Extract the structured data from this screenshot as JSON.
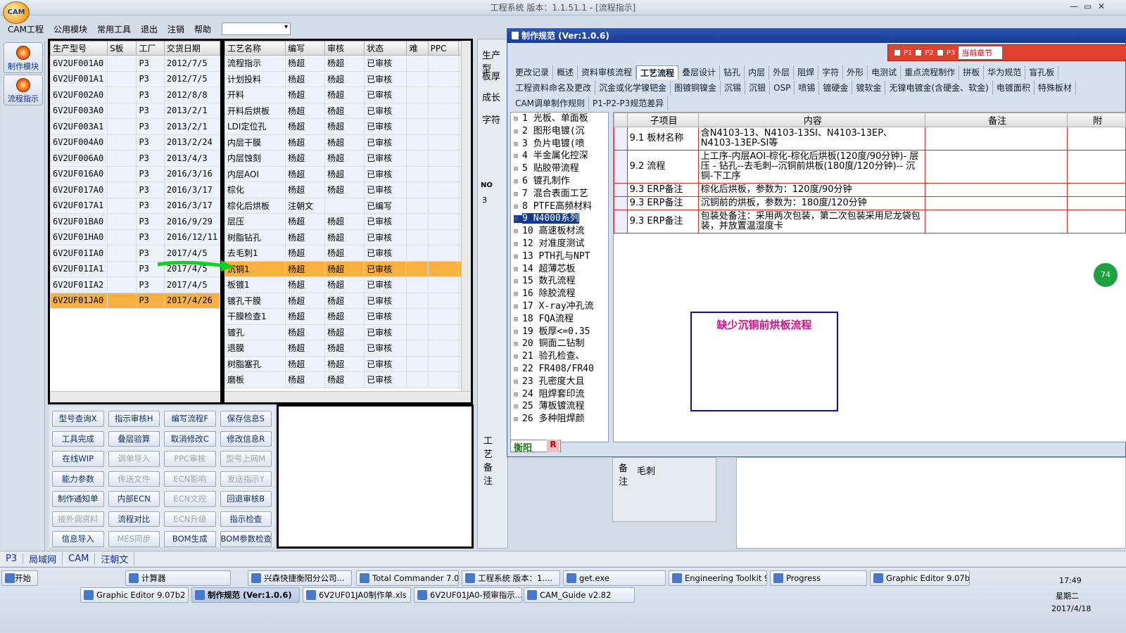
{
  "window": {
    "title": "工程系统   版本：1.1.51.1 - [流程指示]",
    "logo": "CAM"
  },
  "menu": [
    "CAM工程",
    "公用模块",
    "常用工具",
    "退出",
    "注销",
    "帮助"
  ],
  "sidebar": [
    {
      "label": "制作模块"
    },
    {
      "label": "流程指示"
    }
  ],
  "orders": {
    "columns": [
      "生产型号",
      "S板",
      "工厂",
      "交货日期"
    ],
    "rows": [
      [
        "6V2UF001A0",
        "",
        "P3",
        "2012/7/5"
      ],
      [
        "6V2UF001A1",
        "",
        "P3",
        "2012/7/5"
      ],
      [
        "6V2UF002A0",
        "",
        "P3",
        "2012/8/8"
      ],
      [
        "6V2UF003A0",
        "",
        "P3",
        "2013/2/1"
      ],
      [
        "6V2UF003A1",
        "",
        "P3",
        "2013/2/1"
      ],
      [
        "6V2UF004A0",
        "",
        "P3",
        "2013/2/24"
      ],
      [
        "6V2UF006A0",
        "",
        "P3",
        "2013/4/3"
      ],
      [
        "6V2UF016A0",
        "",
        "P3",
        "2016/3/16"
      ],
      [
        "6V2UF017A0",
        "",
        "P3",
        "2016/3/17"
      ],
      [
        "6V2UF017A1",
        "",
        "P3",
        "2016/3/17"
      ],
      [
        "6V2UF01BA0",
        "",
        "P3",
        "2016/9/29"
      ],
      [
        "6V2UF01HA0",
        "",
        "P3",
        "2016/12/11"
      ],
      [
        "6V2UF01IA0",
        "",
        "P3",
        "2017/4/5"
      ],
      [
        "6V2UF01IA1",
        "",
        "P3",
        "2017/4/5"
      ],
      [
        "6V2UF01IA2",
        "",
        "P3",
        "2017/4/5"
      ],
      [
        "6V2UF01JA0",
        "",
        "P3",
        "2017/4/26"
      ]
    ],
    "selected_index": 15
  },
  "process": {
    "columns": [
      "工艺名称",
      "编写",
      "审核",
      "状态",
      "难",
      "PPC",
      "文"
    ],
    "rows": [
      [
        "流程指示",
        "杨超",
        "杨超",
        "已审核"
      ],
      [
        "计划投料",
        "杨超",
        "杨超",
        "已审核"
      ],
      [
        "开料",
        "杨超",
        "杨超",
        "已审核"
      ],
      [
        "开料后烘板",
        "杨超",
        "杨超",
        "已审核"
      ],
      [
        "LDI定位孔",
        "杨超",
        "杨超",
        "已审核"
      ],
      [
        "内层干膜",
        "杨超",
        "杨超",
        "已审核"
      ],
      [
        "内层蚀刻",
        "杨超",
        "杨超",
        "已审核"
      ],
      [
        "内层AOI",
        "杨超",
        "杨超",
        "已审核"
      ],
      [
        "棕化",
        "杨超",
        "杨超",
        "已审核"
      ],
      [
        "棕化后烘板",
        "注朝文",
        "",
        "已编写"
      ],
      [
        "层压",
        "杨超",
        "杨超",
        "已审核"
      ],
      [
        "树脂钻孔",
        "杨超",
        "杨超",
        "已审核"
      ],
      [
        "去毛刺1",
        "杨超",
        "杨超",
        "已审核"
      ],
      [
        "沉铜1",
        "杨超",
        "杨超",
        "已审核"
      ],
      [
        "板镀1",
        "杨超",
        "杨超",
        "已审核"
      ],
      [
        "镀孔干膜",
        "杨超",
        "杨超",
        "已审核"
      ],
      [
        "干膜检查1",
        "杨超",
        "杨超",
        "已审核"
      ],
      [
        "镀孔",
        "杨超",
        "杨超",
        "已审核"
      ],
      [
        "退膜",
        "杨超",
        "杨超",
        "已审核"
      ],
      [
        "树脂塞孔",
        "杨超",
        "杨超",
        "已审核"
      ],
      [
        "磨板",
        "杨超",
        "杨超",
        "已审核"
      ]
    ],
    "selected_index": 13
  },
  "buttons": [
    [
      "型号查询X",
      "指示审核H",
      "编写流程F",
      "保存信息S"
    ],
    [
      "工具完成",
      "叠层验算",
      "取消修改C",
      "修改信息R"
    ],
    [
      "在线WIP",
      "调单导入",
      "PPC审核",
      "型号上网M"
    ],
    [
      "能力参数",
      "传送文件",
      "ECN影响",
      "发送指示Y"
    ],
    [
      "制作通知单",
      "内部ECN",
      "ECN文控",
      "回退审核B"
    ],
    [
      "接外调资料",
      "流程对比",
      "ECN升级",
      "指示检查"
    ],
    [
      "信息导入",
      "MES同步",
      "BOM生成",
      "BOM参数检查"
    ]
  ],
  "disabled_buttons": [
    "调单导入",
    "PPC审核",
    "型号上网M",
    "传送文件",
    "ECN影响",
    "发送指示Y",
    "ECN文控",
    "接外调资料",
    "ECN升级",
    "MES同步"
  ],
  "side_labels": {
    "a": "生产型",
    "b": "板厚",
    "c": "成长",
    "d": "字符",
    "no": "NO",
    "no_val": "3",
    "proc": "工艺备注",
    "remark": "备注",
    "remark_text": "毛刺"
  },
  "dialog": {
    "title": "制作规范 (Ver:1.0.6)",
    "checks": [
      "P1",
      "P2",
      "P3"
    ],
    "chapter": "当前章节",
    "tabs1": [
      "更改记录",
      "概述",
      "资料审核流程",
      "工艺流程",
      "叠层设计",
      "钻孔",
      "内层",
      "外层",
      "阻焊",
      "字符",
      "外形",
      "电测试",
      "重点流程制作",
      "拼板",
      "华为规范",
      "盲孔板"
    ],
    "tabs2": [
      "工程资料命名及更改",
      "沉金或化学镍钯金",
      "图镀铜镍金",
      "沉锡",
      "沉银",
      "OSP",
      "喷锡",
      "镀硬金",
      "镀软金",
      "无镍电镀金(含硬金、软金)",
      "电镀面积",
      "特殊板材"
    ],
    "tabs3": [
      "CAM调单制作规则",
      "P1-P2-P3规范差异"
    ],
    "tree": [
      "1 光板、单面板",
      "2 图形电镀(沉",
      "3 负片电镀(喷",
      "4 半金属化控深",
      "5 贴胶带流程",
      "6 镀孔制作",
      "7 混合表面工艺",
      "8 PTFE高频材料",
      "9 N4000系列",
      "10 高速板材流",
      "12 对准度测试",
      "13 PTH孔与NPT",
      "14 超薄芯板",
      "15 数孔流程",
      "16 除胶流程",
      "17 X-ray冲孔流",
      "18 FQA流程",
      "19 板厚<=0.35",
      "20 铜面二钻制",
      "21 验孔检查、",
      "22 FR408/FR40",
      "23 孔密度大且",
      "24 阻焊套印流",
      "25 薄板镀流程",
      "26 多种阻焊颜"
    ],
    "tree_selected": 8,
    "grid_cols": [
      "子项目",
      "内容",
      "备注",
      "附"
    ],
    "grid_rows": [
      [
        "9.1 板材名称",
        "含N4103-13、N4103-13SI、N4103-13EP、N4103-13EP-SI等"
      ],
      [
        "9.2 流程",
        "上工序-内层AOI-棕化-棕化后烘板(120度/90分钟)- 层压 - 钻孔--去毛刺--沉铜前烘板(180度/120分钟)-- 沉铜-下工序"
      ],
      [
        "9.3 ERP备注",
        "棕化后烘板，参数为：120度/90分钟"
      ],
      [
        "9.3 ERP备注",
        "沉铜前的烘板，参数为：180度/120分钟"
      ],
      [
        "9.3 ERP备注",
        "包装处备注：采用两次包装，第二次包装采用尼龙袋包装，并放置温湿度卡"
      ]
    ],
    "annotation": "缺少沉铜前烘板流程",
    "footer": "衡阳",
    "footer_r": "R",
    "badge": "74"
  },
  "status": [
    "P3",
    "局域网",
    "CAM",
    "汪朝文"
  ],
  "taskbar": {
    "start": "开始",
    "row1": [
      "计算器",
      "兴森快捷衡阳分公司...",
      "Total Commander 7.0 ...",
      "工程系统  版本：1....",
      "get.exe",
      "Engineering Toolkit 9....",
      "Progress",
      "Graphic Editor 9.07b2 ..."
    ],
    "row2": [
      "Graphic Editor 9.07b2 (0...",
      "制作规范 (Ver:1.0.6)",
      "6V2UF01JA0制作单.xls ...",
      "6V2UF01JA0-预审指示....",
      "CAM_Guide v2.82"
    ],
    "time": "17:49",
    "day": "星期二",
    "date": "2017/4/18"
  },
  "colors": {
    "accent": "#f8b040",
    "dialog_title": "#1a3a8c",
    "annotation": "#d0108a"
  }
}
